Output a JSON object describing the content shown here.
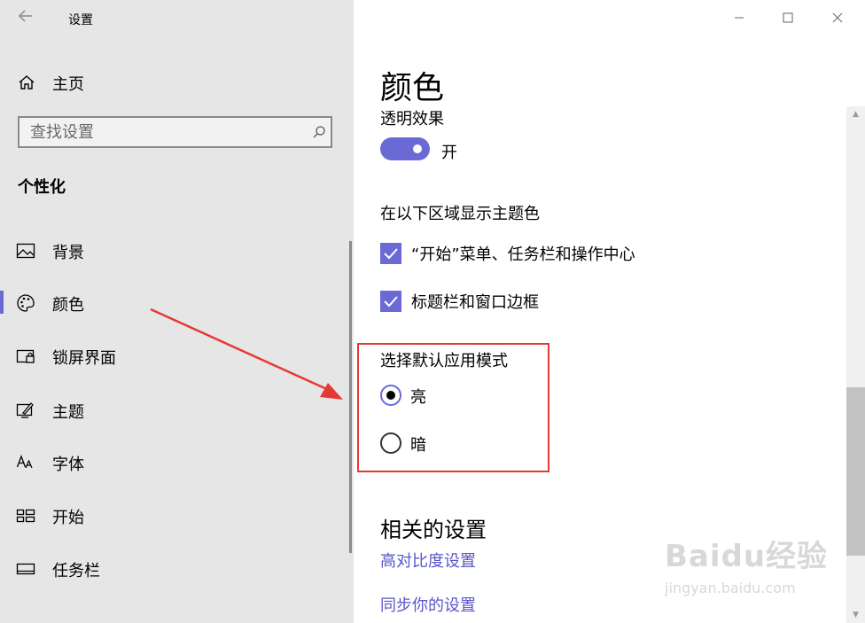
{
  "window": {
    "title": "设置",
    "minimize_icon": "minimize-icon",
    "maximize_icon": "maximize-icon",
    "close_icon": "close-icon"
  },
  "sidebar": {
    "home_label": "主页",
    "search": {
      "placeholder": "查找设置",
      "value": ""
    },
    "section_title": "个性化",
    "items": [
      {
        "label": "背景",
        "icon": "picture-icon",
        "active": false
      },
      {
        "label": "颜色",
        "icon": "palette-icon",
        "active": true
      },
      {
        "label": "锁屏界面",
        "icon": "lock-screen-icon",
        "active": false
      },
      {
        "label": "主题",
        "icon": "theme-icon",
        "active": false
      },
      {
        "label": "字体",
        "icon": "font-icon",
        "active": false
      },
      {
        "label": "开始",
        "icon": "start-icon",
        "active": false
      },
      {
        "label": "任务栏",
        "icon": "taskbar-icon",
        "active": false
      }
    ],
    "accent_color": "#6b69d6"
  },
  "main": {
    "title": "颜色",
    "transparency": {
      "label": "透明效果",
      "state_label": "开",
      "on": true
    },
    "accent_surfaces": {
      "heading": "在以下区域显示主题色",
      "options": [
        {
          "label": "“开始”菜单、任务栏和操作中心",
          "checked": true
        },
        {
          "label": "标题栏和窗口边框",
          "checked": true
        }
      ]
    },
    "app_mode": {
      "heading": "选择默认应用模式",
      "options": [
        {
          "label": "亮",
          "selected": true
        },
        {
          "label": "暗",
          "selected": false
        }
      ],
      "highlight_color": "#e53935"
    },
    "related": {
      "heading": "相关的设置",
      "links": [
        "高对比度设置",
        "同步你的设置"
      ]
    }
  },
  "watermark": {
    "brand": "Baidu经验",
    "url": "jingyan.baidu.com"
  }
}
